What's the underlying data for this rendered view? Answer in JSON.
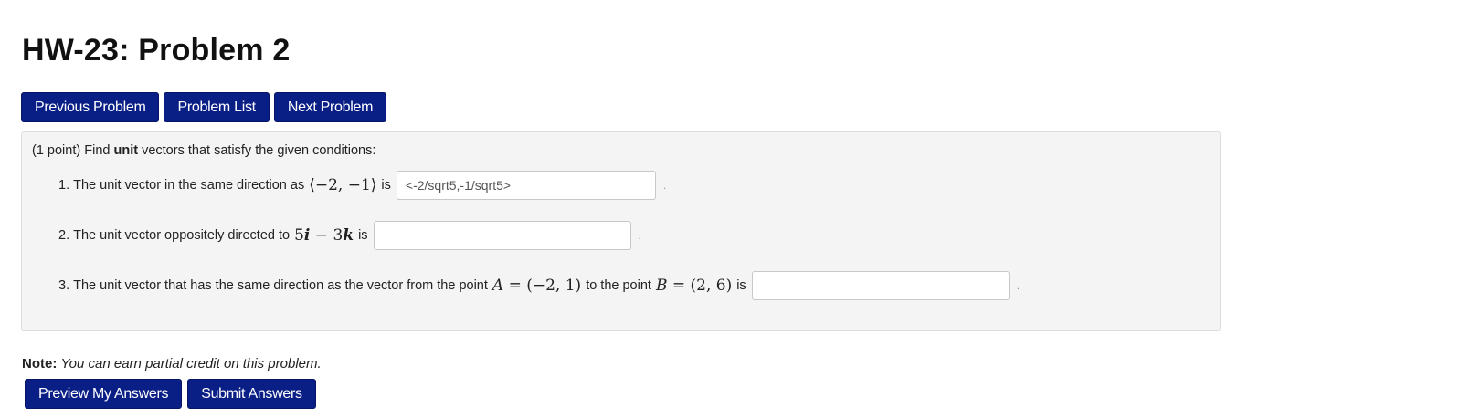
{
  "page": {
    "title": "HW-23: Problem 2"
  },
  "nav": {
    "previous_label": "Previous Problem",
    "list_label": "Problem List",
    "next_label": "Next Problem"
  },
  "problem": {
    "points": "(1 point)",
    "intro_pre": "Find",
    "intro_bold": "unit",
    "intro_post": "vectors that satisfy the given conditions:",
    "items": [
      {
        "number": "1.",
        "text": "The unit vector in the same direction as",
        "math": "⟨−2, −1⟩",
        "suffix": "is",
        "answer_value": "<-2/sqrt5,-1/sqrt5>",
        "period": "."
      },
      {
        "number": "2.",
        "text": "The unit vector oppositely directed to",
        "math_coef1": "5",
        "math_var1": "i",
        "math_op": "−",
        "math_coef2": "3",
        "math_var2": "k",
        "suffix": "is",
        "answer_value": "",
        "period": "."
      },
      {
        "number": "3.",
        "text": "The unit vector that has the same direction as the vector from the point",
        "math_a_var": "A",
        "math_a_val": "= (−2, 1)",
        "middle": "to the point",
        "math_b_var": "B",
        "math_b_val": "= (2, 6)",
        "suffix": "is",
        "answer_value": "",
        "period": "."
      }
    ]
  },
  "note": {
    "label": "Note:",
    "text": "You can earn partial credit on this problem."
  },
  "actions": {
    "preview_label": "Preview My Answers",
    "submit_label": "Submit Answers"
  },
  "colors": {
    "button_bg": "#0a1f86",
    "button_text": "#ffffff",
    "panel_bg": "#f4f4f4",
    "panel_border": "#dddddd"
  }
}
